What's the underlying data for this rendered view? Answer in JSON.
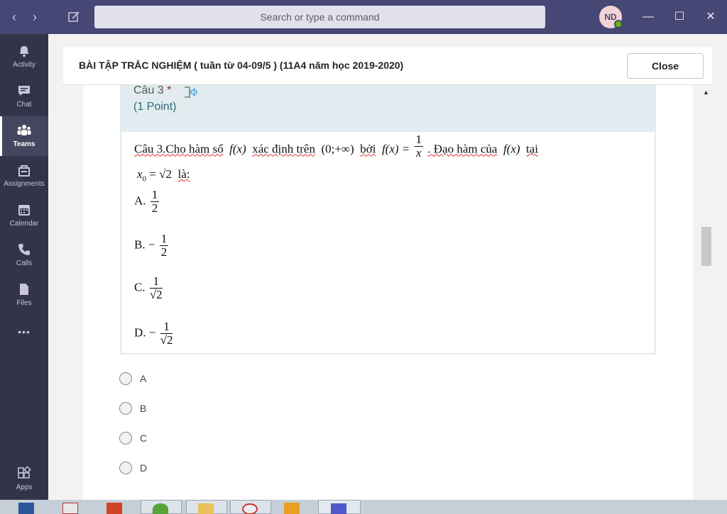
{
  "titlebar": {
    "search_placeholder": "Search or type a command",
    "avatar_initials": "ND",
    "back_icon": "chevron-left-icon",
    "forward_icon": "chevron-right-icon",
    "compose_icon": "compose-icon",
    "accent": "#464775"
  },
  "rail": {
    "items": [
      {
        "label": "Activity",
        "icon": "bell-icon"
      },
      {
        "label": "Chat",
        "icon": "chat-icon"
      },
      {
        "label": "Teams",
        "icon": "teams-icon",
        "active": true
      },
      {
        "label": "Assignments",
        "icon": "assignments-icon"
      },
      {
        "label": "Calendar",
        "icon": "calendar-icon"
      },
      {
        "label": "Calls",
        "icon": "phone-icon"
      },
      {
        "label": "Files",
        "icon": "file-icon"
      }
    ],
    "more": "•••",
    "apps_label": "Apps"
  },
  "dialog": {
    "title": "BÀI TẬP TRẮC NGHIỆM ( tuần từ 04-09/5 ) (11A4 năm học 2019-2020)",
    "close_label": "Close"
  },
  "question": {
    "number": "Câu 3",
    "required_mark": "*",
    "points": "(1 Point)",
    "image_text": {
      "line1_a": "Câu 3.Cho hàm số",
      "fx": "f(x)",
      "line1_b": "xác định trên",
      "interval": "(0;+∞)",
      "line1_c": "bởi",
      "eq": "f(x) =",
      "one": "1",
      "x": "x",
      "line1_d": ". Đạo hàm của",
      "line1_e": "tại",
      "line2_a": "x",
      "line2_sub": "0",
      "line2_b": "= √2",
      "line2_c": "là:",
      "A_prefix": "A.",
      "A_num": "1",
      "A_den": "2",
      "B_prefix": "B. −",
      "B_num": "1",
      "B_den": "2",
      "C_prefix": "C.",
      "C_num": "1",
      "C_den": "√2",
      "D_prefix": "D. −",
      "D_num": "1",
      "D_den": "√2"
    },
    "options": [
      "A",
      "B",
      "C",
      "D"
    ]
  }
}
